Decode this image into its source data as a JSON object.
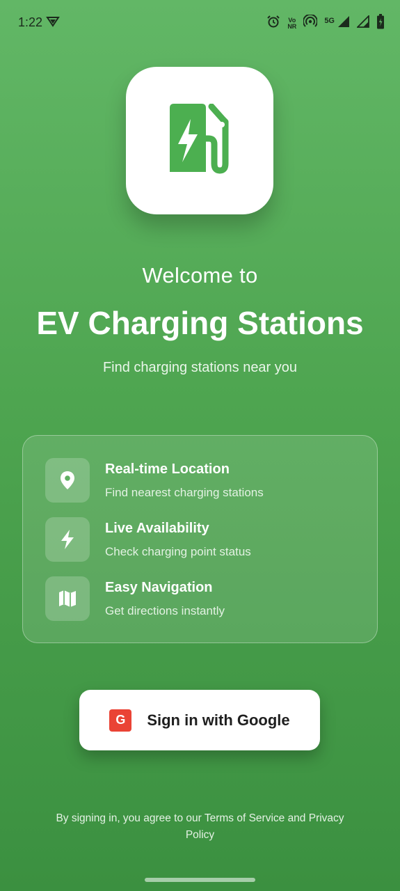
{
  "status_bar": {
    "time": "1:22",
    "volte_top": "Vo",
    "volte_bottom": "NR",
    "network": "5G"
  },
  "logo": {
    "icon": "ev-charger-icon",
    "color": "#4caf50"
  },
  "header": {
    "welcome": "Welcome to",
    "title": "EV Charging Stations",
    "tagline": "Find charging stations near you"
  },
  "features": [
    {
      "icon": "location-pin-icon",
      "title": "Real-time Location",
      "description": "Find nearest charging stations"
    },
    {
      "icon": "lightning-bolt-icon",
      "title": "Live Availability",
      "description": "Check charging point status"
    },
    {
      "icon": "map-icon",
      "title": "Easy Navigation",
      "description": "Get directions instantly"
    }
  ],
  "google_button": {
    "badge": "G",
    "label": "Sign in with Google",
    "badge_color": "#ea4335"
  },
  "legal": "By signing in, you agree to our Terms of Service and Privacy Policy",
  "colors": {
    "background_top": "#62b766",
    "background_bottom": "#3b9040",
    "accent": "#4caf50"
  }
}
